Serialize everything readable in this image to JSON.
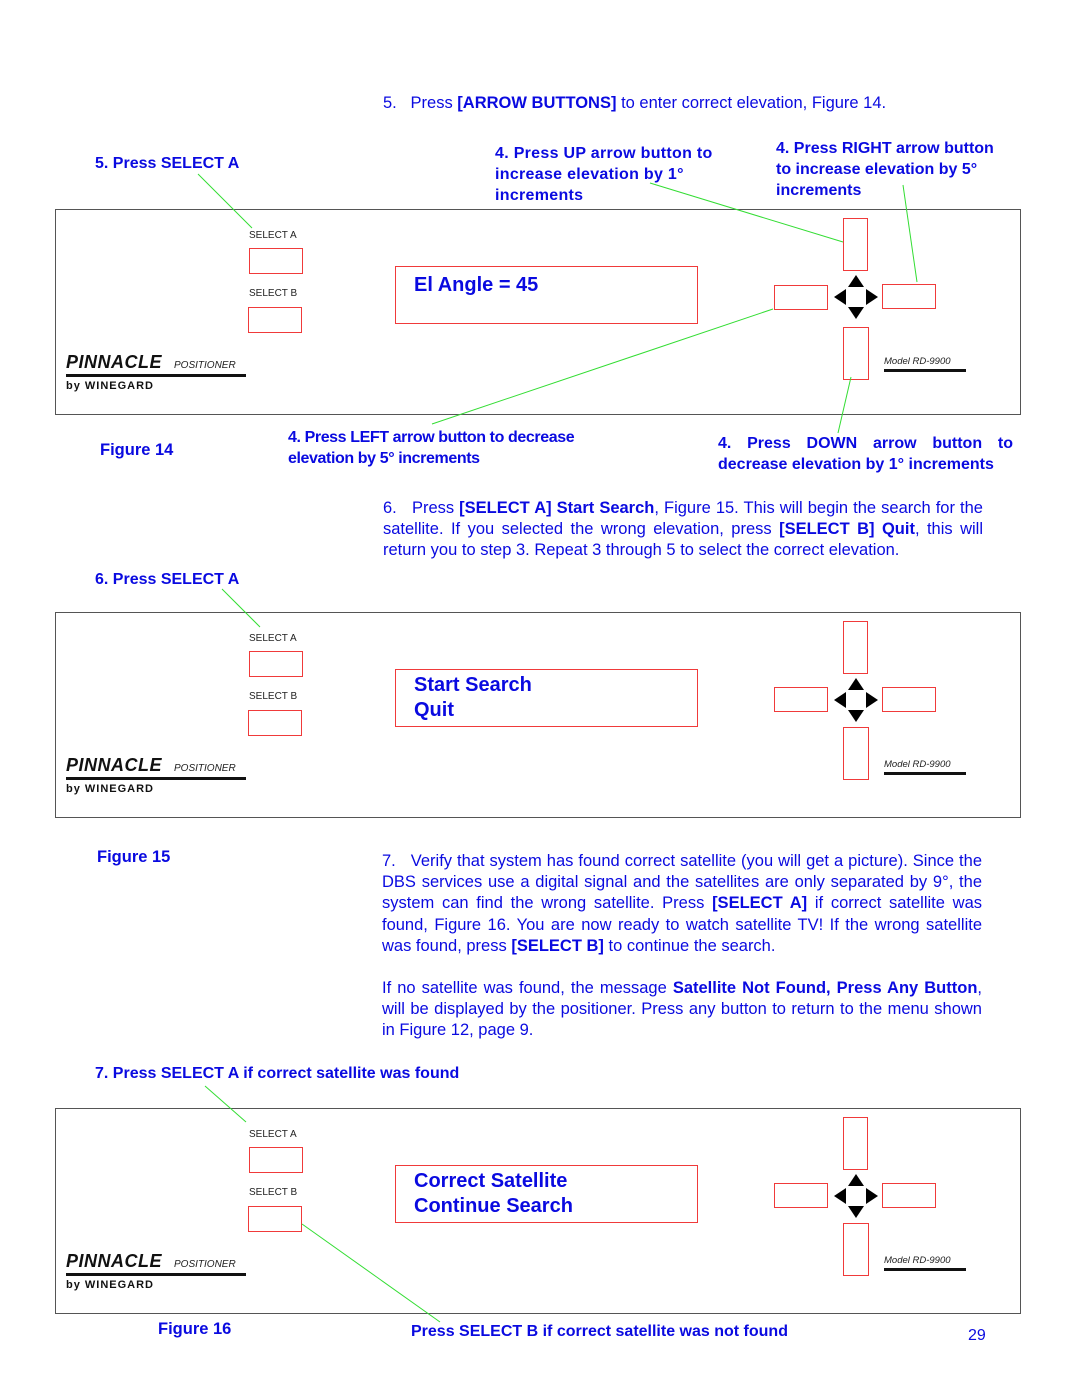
{
  "page_number": "29",
  "colors": {
    "text_blue": "#0a0ae0",
    "button_red": "#f03a3a",
    "leader_green": "#33dd33",
    "panel_border": "#555555"
  },
  "step5": {
    "num": "5.",
    "pre": "Press ",
    "bold": "[ARROW BUTTONS]",
    "post": " to enter correct elevation, Figure 14."
  },
  "figure14": {
    "label": "Figure 14",
    "callout_select": "5. Press SELECT A",
    "callout_up": "4. Press UP arrow button to increase elevation by 1° increments",
    "callout_right": "4. Press RIGHT arrow button to increase elevation by 5° increments",
    "callout_left": "4. Press LEFT arrow button to decrease elevation by 5° increments",
    "callout_down": "4. Press DOWN arrow button to decrease elevation by 1° increments",
    "lcd_lines": [
      "El Angle = 45"
    ]
  },
  "step6": {
    "num": "6.",
    "p1": "Press ",
    "b1": "[SELECT A] Start Search",
    "p2": ", Figure 15.  This will begin the search for the satellite.  If you selected the wrong elevation, press ",
    "b2": "[SELECT B] Quit",
    "p3": ", this will return you to step 3.  Repeat 3 through 5 to select the correct elevation."
  },
  "figure15": {
    "label": "Figure 15",
    "callout_select": "6. Press SELECT A",
    "lcd_lines": [
      "Start Search",
      "Quit"
    ]
  },
  "step7": {
    "num": "7.",
    "p1": "Verify that system has found correct satellite (you will get a picture).  Since the DBS services use a digital signal and the satellites are only separated by 9°, the system can find the wrong satellite.  Press ",
    "b1": "[SELECT A]",
    "p2": " if correct satellite was found, Figure 16.  You are now ready to watch satellite TV!  If the wrong satellite was found, press ",
    "b2": "[SELECT B]",
    "p3": " to continue the search."
  },
  "no_satellite": {
    "p1": "If no satellite was found, the message ",
    "b1": "Satellite Not Found, Press Any Button",
    "p2": ", will be displayed by the positioner.  Press any button to return to the menu shown in Figure 12, page 9."
  },
  "figure16": {
    "label": "Figure 16",
    "callout_select_a": "7. Press SELECT A if correct satellite was found",
    "callout_select_b": "Press SELECT B if correct satellite was not found",
    "lcd_lines": [
      "Correct Satellite",
      "Continue Search"
    ]
  },
  "device": {
    "select_a_label": "SELECT A",
    "select_b_label": "SELECT B",
    "brand_name": "PINNACLE",
    "brand_sub": "POSITIONER",
    "brand_maker": "by WINEGARD",
    "model": "Model RD-9900",
    "icons": [
      "arrow-up-icon",
      "arrow-down-icon",
      "arrow-left-icon",
      "arrow-right-icon"
    ]
  }
}
